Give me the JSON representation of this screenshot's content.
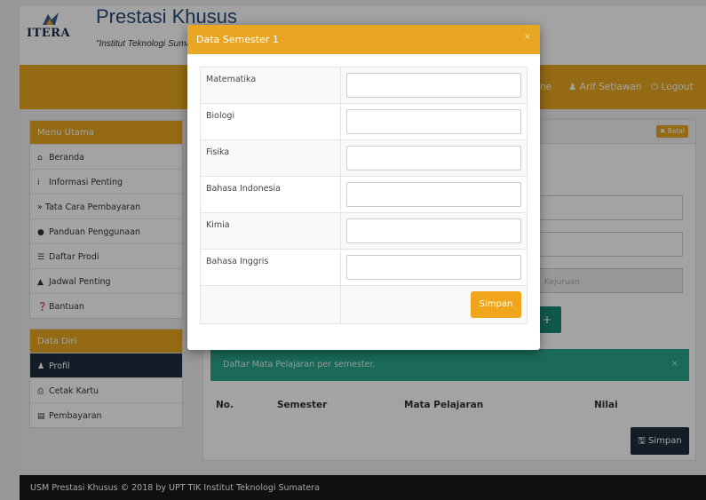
{
  "header": {
    "logo_text": "ITERA",
    "title": "Prestasi Khusus",
    "tagline": "\"Institut Teknologi Sumatera\""
  },
  "navbar": {
    "home_label": "ne",
    "user_label": "Arif Setiawan",
    "logout_label": "Logout"
  },
  "sidebar": {
    "menu_title": "Menu Utama",
    "menu_items": [
      {
        "label": "Beranda",
        "icon": "home-icon"
      },
      {
        "label": "Informasi Penting",
        "icon": "info-icon"
      },
      {
        "label": "» Tata Cara Pembayaran",
        "icon": ""
      },
      {
        "label": "Panduan Penggunaan",
        "icon": "exclamation-circle-icon"
      },
      {
        "label": "Daftar Prodi",
        "icon": "list-icon"
      },
      {
        "label": "Jadwal Penting",
        "icon": "warning-icon"
      },
      {
        "label": "Bantuan",
        "icon": "question-circle-icon"
      }
    ],
    "data_title": "Data Diri",
    "data_items": [
      {
        "label": "Profil",
        "icon": "user-icon"
      },
      {
        "label": "Cetak Kartu",
        "icon": "print-icon"
      },
      {
        "label": "Pembayaran",
        "icon": "credit-card-icon"
      }
    ]
  },
  "main": {
    "batal_label": "Batal",
    "kejuruan_placeholder": "Kejuruan",
    "plus_label": "+",
    "alert_text": "Daftar Mata Pelajaran per semester.",
    "alert_close": "×",
    "table_headers": [
      "No.",
      "Semester",
      "Mata Pelajaran",
      "Nilai"
    ],
    "simpan_label": "Simpan"
  },
  "modal": {
    "title": "Data Semester 1",
    "close": "×",
    "subjects": [
      "Matematika",
      "Biologi",
      "Fisika",
      "Bahasa Indonesia",
      "Kimia",
      "Bahasa Inggris"
    ],
    "simpan_label": "Simpan"
  },
  "footer": {
    "text": "USM Prestasi Khusus © 2018 by UPT TIK Institut Teknologi Sumatera"
  },
  "colors": {
    "accent": "#e8a622",
    "dark": "#1f2d3d",
    "success": "#2aa58c",
    "modal_button": "#f0a51b"
  }
}
